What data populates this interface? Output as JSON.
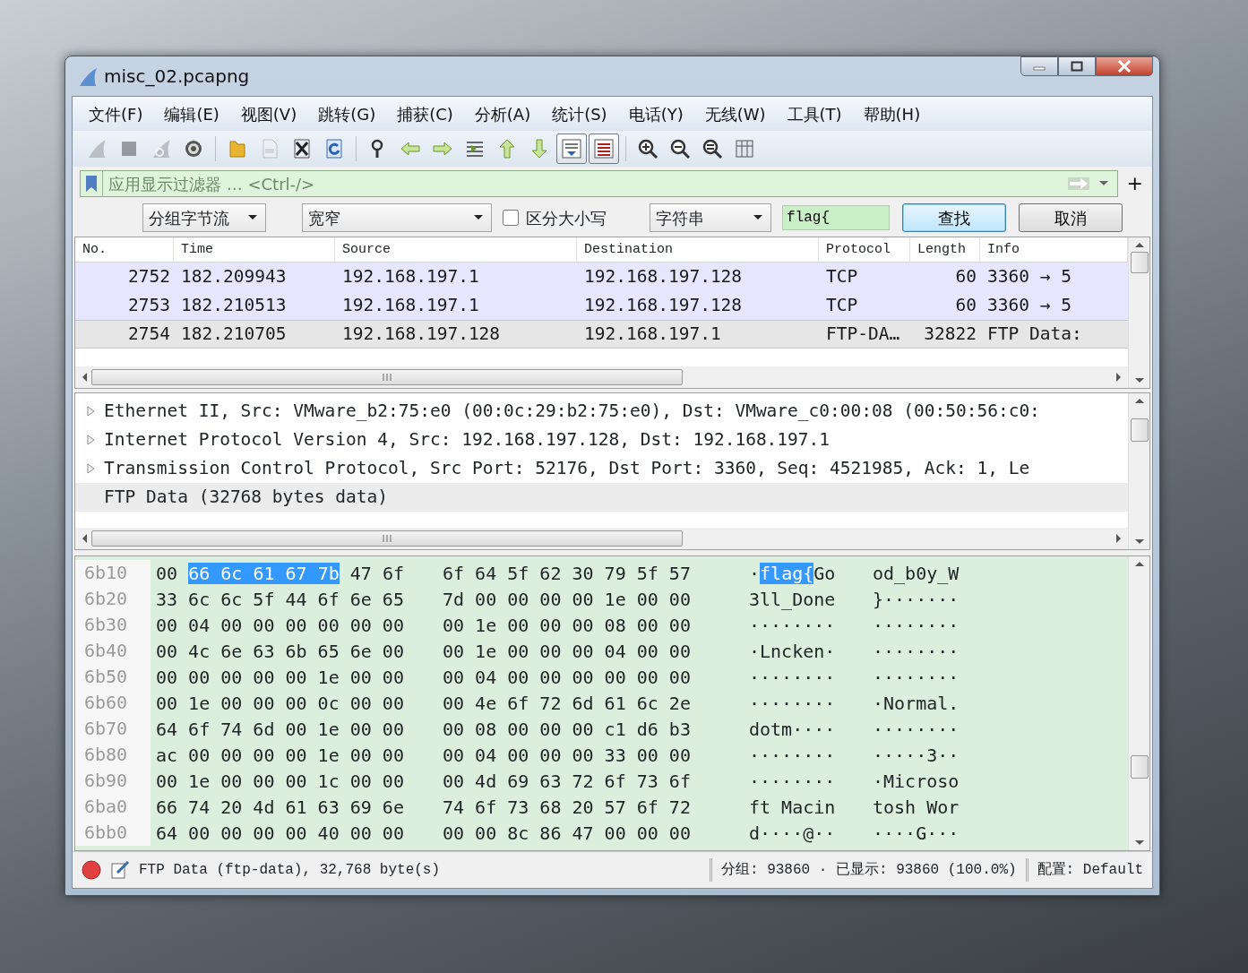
{
  "window": {
    "title": "misc_02.pcapng"
  },
  "menu": [
    "文件(F)",
    "编辑(E)",
    "视图(V)",
    "跳转(G)",
    "捕获(C)",
    "分析(A)",
    "统计(S)",
    "电话(Y)",
    "无线(W)",
    "工具(T)",
    "帮助(H)"
  ],
  "toolbar": [
    [
      {
        "kind": "fin",
        "disabled": true,
        "pressed": false
      },
      {
        "kind": "stop",
        "disabled": true,
        "pressed": false
      },
      {
        "kind": "restart",
        "disabled": true,
        "pressed": false
      },
      {
        "kind": "gear",
        "disabled": false,
        "pressed": false
      }
    ],
    [
      {
        "kind": "folder",
        "disabled": false,
        "pressed": false
      },
      {
        "kind": "file",
        "disabled": true,
        "pressed": false
      },
      {
        "kind": "closefile",
        "disabled": false,
        "pressed": false
      },
      {
        "kind": "reload",
        "disabled": false,
        "pressed": false
      }
    ],
    [
      {
        "kind": "find",
        "disabled": false,
        "pressed": false
      },
      {
        "kind": "back",
        "disabled": false,
        "pressed": false
      },
      {
        "kind": "forward",
        "disabled": false,
        "pressed": false
      },
      {
        "kind": "goto",
        "disabled": false,
        "pressed": false
      },
      {
        "kind": "first",
        "disabled": false,
        "pressed": false
      },
      {
        "kind": "last",
        "disabled": false,
        "pressed": false
      },
      {
        "kind": "autoscroll",
        "disabled": false,
        "pressed": true
      },
      {
        "kind": "colorize",
        "disabled": false,
        "pressed": true
      }
    ],
    [
      {
        "kind": "zoomin",
        "disabled": false,
        "pressed": false
      },
      {
        "kind": "zoomout",
        "disabled": false,
        "pressed": false
      },
      {
        "kind": "zoomnormal",
        "disabled": false,
        "pressed": false
      },
      {
        "kind": "resize",
        "disabled": false,
        "pressed": false
      }
    ]
  ],
  "display_filter": {
    "placeholder": "应用显示过滤器 … <Ctrl-/>",
    "add_button": "+"
  },
  "find_bar": {
    "search_in": "分组字节流",
    "charset": "宽窄",
    "case_sensitive": {
      "label": "区分大小写",
      "checked": false
    },
    "search_type": "字符串",
    "query": "flag{",
    "find_button": "查找",
    "cancel_button": "取消"
  },
  "packets": {
    "columns": [
      "No.",
      "Time",
      "Source",
      "Destination",
      "Protocol",
      "Length",
      "Info"
    ],
    "rows": [
      {
        "no": "2752",
        "time": "182.209943",
        "source": "192.168.197.1",
        "destination": "192.168.197.128",
        "protocol": "TCP",
        "length": "60",
        "info": "3360 → 5",
        "color": "#e7e6ff",
        "selected": false
      },
      {
        "no": "2753",
        "time": "182.210513",
        "source": "192.168.197.1",
        "destination": "192.168.197.128",
        "protocol": "TCP",
        "length": "60",
        "info": "3360 → 5",
        "color": "#e7e6ff",
        "selected": false
      },
      {
        "no": "2754",
        "time": "182.210705",
        "source": "192.168.197.128",
        "destination": "192.168.197.1",
        "protocol": "FTP-DA…",
        "length": "32822",
        "info": "FTP Data:",
        "color": "#e6e6e6",
        "selected": true
      }
    ]
  },
  "details": [
    {
      "text": "Ethernet II, Src: VMware_b2:75:e0 (00:0c:29:b2:75:e0), Dst: VMware_c0:00:08 (00:50:56:c0:",
      "expandable": true,
      "selected": false
    },
    {
      "text": "Internet Protocol Version 4, Src: 192.168.197.128, Dst: 192.168.197.1",
      "expandable": true,
      "selected": false
    },
    {
      "text": "Transmission Control Protocol, Src Port: 52176, Dst Port: 3360, Seq: 4521985, Ack: 1, Le",
      "expandable": true,
      "selected": false
    },
    {
      "text": "FTP Data (32768 bytes data)",
      "expandable": false,
      "selected": true
    }
  ],
  "hex": [
    {
      "offset": "6b10",
      "hex": [
        [
          {
            "text": "00",
            "selected": false
          },
          {
            "text": "66 6c 61 67 7b",
            "selected": true
          },
          {
            "text": "47 6f",
            "selected": false
          }
        ],
        [
          {
            "text": "6f 64 5f 62 30 79 5f 57",
            "selected": false
          }
        ]
      ],
      "ascii": [
        [
          {
            "text": "·",
            "selected": false
          },
          {
            "text": "flag{",
            "selected": true
          },
          {
            "text": "Go",
            "selected": false
          }
        ],
        [
          {
            "text": "od_b0y_W",
            "selected": false
          }
        ]
      ]
    },
    {
      "offset": "6b20",
      "hex": [
        [
          {
            "text": "33 6c 6c 5f 44 6f 6e 65",
            "selected": false
          }
        ],
        [
          {
            "text": "7d 00 00 00 00 1e 00 00",
            "selected": false
          }
        ]
      ],
      "ascii": [
        [
          {
            "text": "3ll_Done",
            "selected": false
          }
        ],
        [
          {
            "text": "}·······",
            "selected": false
          }
        ]
      ]
    },
    {
      "offset": "6b30",
      "hex": [
        [
          {
            "text": "00 04 00 00 00 00 00 00",
            "selected": false
          }
        ],
        [
          {
            "text": "00 1e 00 00 00 08 00 00",
            "selected": false
          }
        ]
      ],
      "ascii": [
        [
          {
            "text": "········",
            "selected": false
          }
        ],
        [
          {
            "text": "········",
            "selected": false
          }
        ]
      ]
    },
    {
      "offset": "6b40",
      "hex": [
        [
          {
            "text": "00 4c 6e 63 6b 65 6e 00",
            "selected": false
          }
        ],
        [
          {
            "text": "00 1e 00 00 00 04 00 00",
            "selected": false
          }
        ]
      ],
      "ascii": [
        [
          {
            "text": "·Lncken·",
            "selected": false
          }
        ],
        [
          {
            "text": "········",
            "selected": false
          }
        ]
      ]
    },
    {
      "offset": "6b50",
      "hex": [
        [
          {
            "text": "00 00 00 00 00 1e 00 00",
            "selected": false
          }
        ],
        [
          {
            "text": "00 04 00 00 00 00 00 00",
            "selected": false
          }
        ]
      ],
      "ascii": [
        [
          {
            "text": "········",
            "selected": false
          }
        ],
        [
          {
            "text": "········",
            "selected": false
          }
        ]
      ]
    },
    {
      "offset": "6b60",
      "hex": [
        [
          {
            "text": "00 1e 00 00 00 0c 00 00",
            "selected": false
          }
        ],
        [
          {
            "text": "00 4e 6f 72 6d 61 6c 2e",
            "selected": false
          }
        ]
      ],
      "ascii": [
        [
          {
            "text": "········",
            "selected": false
          }
        ],
        [
          {
            "text": "·Normal.",
            "selected": false
          }
        ]
      ]
    },
    {
      "offset": "6b70",
      "hex": [
        [
          {
            "text": "64 6f 74 6d 00 1e 00 00",
            "selected": false
          }
        ],
        [
          {
            "text": "00 08 00 00 00 c1 d6 b3",
            "selected": false
          }
        ]
      ],
      "ascii": [
        [
          {
            "text": "dotm····",
            "selected": false
          }
        ],
        [
          {
            "text": "········",
            "selected": false
          }
        ]
      ]
    },
    {
      "offset": "6b80",
      "hex": [
        [
          {
            "text": "ac 00 00 00 00 1e 00 00",
            "selected": false
          }
        ],
        [
          {
            "text": "00 04 00 00 00 33 00 00",
            "selected": false
          }
        ]
      ],
      "ascii": [
        [
          {
            "text": "········",
            "selected": false
          }
        ],
        [
          {
            "text": "·····3··",
            "selected": false
          }
        ]
      ]
    },
    {
      "offset": "6b90",
      "hex": [
        [
          {
            "text": "00 1e 00 00 00 1c 00 00",
            "selected": false
          }
        ],
        [
          {
            "text": "00 4d 69 63 72 6f 73 6f",
            "selected": false
          }
        ]
      ],
      "ascii": [
        [
          {
            "text": "········",
            "selected": false
          }
        ],
        [
          {
            "text": "·Microso",
            "selected": false
          }
        ]
      ]
    },
    {
      "offset": "6ba0",
      "hex": [
        [
          {
            "text": "66 74 20 4d 61 63 69 6e",
            "selected": false
          }
        ],
        [
          {
            "text": "74 6f 73 68 20 57 6f 72",
            "selected": false
          }
        ]
      ],
      "ascii": [
        [
          {
            "text": "ft Macin",
            "selected": false
          }
        ],
        [
          {
            "text": "tosh Wor",
            "selected": false
          }
        ]
      ]
    },
    {
      "offset": "6bb0",
      "hex": [
        [
          {
            "text": "64 00 00 00 00 40 00 00",
            "selected": false
          }
        ],
        [
          {
            "text": "00 00 8c 86 47 00 00 00",
            "selected": false
          }
        ]
      ],
      "ascii": [
        [
          {
            "text": "d····@··",
            "selected": false
          }
        ],
        [
          {
            "text": "····G···",
            "selected": false
          }
        ]
      ]
    }
  ],
  "status_bar": {
    "field_info": "FTP Data (ftp-data), 32,768 byte(s)",
    "packets": "分组: 93860 · 已显示: 93860 (100.0%)",
    "profile": "配置: Default"
  }
}
